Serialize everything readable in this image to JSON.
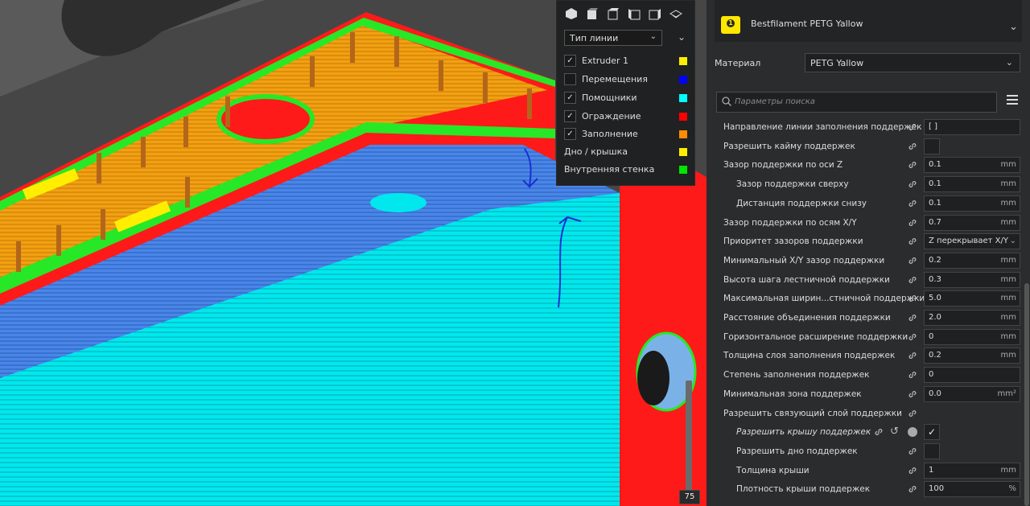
{
  "legend": {
    "line_type_label": "Тип линии",
    "items": [
      {
        "label": "Extruder 1",
        "checked": true,
        "color": "#ffee00",
        "has_checkbox": true
      },
      {
        "label": "Перемещения",
        "checked": false,
        "color": "#0000ff",
        "has_checkbox": true
      },
      {
        "label": "Помощники",
        "checked": true,
        "color": "#00ffff",
        "has_checkbox": true
      },
      {
        "label": "Ограждение",
        "checked": true,
        "color": "#ff0000",
        "has_checkbox": true
      },
      {
        "label": "Заполнение",
        "checked": true,
        "color": "#ff8c00",
        "has_checkbox": true
      },
      {
        "label": "Дно / крышка",
        "checked": false,
        "color": "#ffee00",
        "has_checkbox": false
      },
      {
        "label": "Внутренняя стенка",
        "checked": false,
        "color": "#00e600",
        "has_checkbox": false
      }
    ],
    "view_icons": [
      "3d-view-icon",
      "front-view-icon",
      "top-view-icon",
      "left-view-icon",
      "right-view-icon",
      "x-ray-view-icon"
    ]
  },
  "layer_slider": {
    "value": "75"
  },
  "material_header": {
    "name": "Bestfilament PETG Yallow",
    "badge_color": "#ffe700"
  },
  "material": {
    "label": "Материал",
    "value": "PETG Yallow"
  },
  "search": {
    "placeholder": "Параметры поиска"
  },
  "settings": [
    {
      "label": "Направление линии заполнения поддержек",
      "value": "[ ]",
      "unit": "",
      "indent": false,
      "type": "text"
    },
    {
      "label": "Разрешить кайму поддержек",
      "value": "",
      "unit": "",
      "indent": false,
      "type": "checkbox",
      "checked": false
    },
    {
      "label": "Зазор поддержки по оси Z",
      "value": "0.1",
      "unit": "mm",
      "indent": false,
      "type": "text"
    },
    {
      "label": "Зазор поддержки сверху",
      "value": "0.1",
      "unit": "mm",
      "indent": true,
      "type": "text"
    },
    {
      "label": "Дистанция поддержки снизу",
      "value": "0.1",
      "unit": "mm",
      "indent": true,
      "type": "text"
    },
    {
      "label": "Зазор поддержки по осям X/Y",
      "value": "0.7",
      "unit": "mm",
      "indent": false,
      "type": "text"
    },
    {
      "label": "Приоритет зазоров поддержки",
      "value": "Z перекрывает X/Y",
      "unit": "",
      "indent": false,
      "type": "select"
    },
    {
      "label": "Минимальный X/Y зазор поддержки",
      "value": "0.2",
      "unit": "mm",
      "indent": false,
      "type": "text"
    },
    {
      "label": "Высота шага лестничной поддержки",
      "value": "0.3",
      "unit": "mm",
      "indent": false,
      "type": "text"
    },
    {
      "label": "Максимальная ширин...стничной поддержки",
      "value": "5.0",
      "unit": "mm",
      "indent": false,
      "type": "text"
    },
    {
      "label": "Расстояние объединения поддержки",
      "value": "2.0",
      "unit": "mm",
      "indent": false,
      "type": "text"
    },
    {
      "label": "Горизонтальное расширение поддержки",
      "value": "0",
      "unit": "mm",
      "indent": false,
      "type": "text"
    },
    {
      "label": "Толщина слоя заполнения поддержек",
      "value": "0.2",
      "unit": "mm",
      "indent": false,
      "type": "text"
    },
    {
      "label": "Степень заполнения поддержек",
      "value": "0",
      "unit": "",
      "indent": false,
      "type": "text"
    },
    {
      "label": "Минимальная зона поддержек",
      "value": "0.0",
      "unit": "mm²",
      "indent": false,
      "type": "text"
    },
    {
      "label": "Разрешить связующий слой поддержки",
      "value": "",
      "unit": "",
      "indent": false,
      "type": "none"
    },
    {
      "label": "Разрешить крышу поддержек",
      "value": "✓",
      "unit": "",
      "indent": true,
      "type": "checkbox",
      "checked": true,
      "italic": true
    },
    {
      "label": "Разрешить дно поддержек",
      "value": "",
      "unit": "",
      "indent": true,
      "type": "checkbox",
      "checked": false
    },
    {
      "label": "Толщина крыши",
      "value": "1",
      "unit": "mm",
      "indent": true,
      "type": "text"
    },
    {
      "label": "Плотность крыши поддержек",
      "value": "100",
      "unit": "%",
      "indent": true,
      "type": "text"
    }
  ]
}
